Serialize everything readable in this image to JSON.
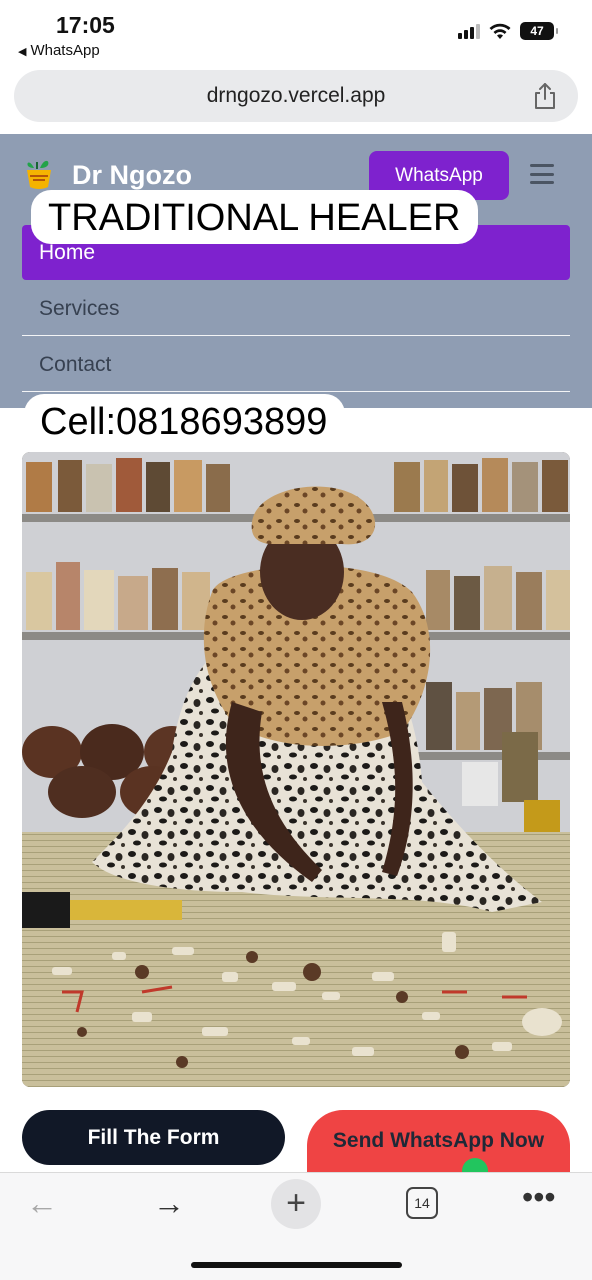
{
  "status_bar": {
    "time": "17:05",
    "back_app": "WhatsApp",
    "battery": "47"
  },
  "browser": {
    "url": "drngozo.vercel.app",
    "tab_count": "14"
  },
  "site": {
    "brand": "Dr Ngozo",
    "whatsapp_button": "WhatsApp",
    "nav": {
      "home": "Home",
      "services": "Services",
      "contact": "Contact"
    },
    "accent_color": "#7e22ce",
    "header_bg": "#8f9db3"
  },
  "captions": {
    "headline": "TRADITIONAL HEALER",
    "cell": "Cell:0818693899"
  },
  "cta": {
    "fill_form": "Fill The Form",
    "send_whatsapp": "Send WhatsApp Now"
  },
  "icons": [
    "share-icon",
    "logo-icon",
    "menu-icon",
    "back-arrow-icon",
    "forward-arrow-icon",
    "new-tab-plus-icon",
    "tabs-count-icon",
    "more-icon"
  ]
}
